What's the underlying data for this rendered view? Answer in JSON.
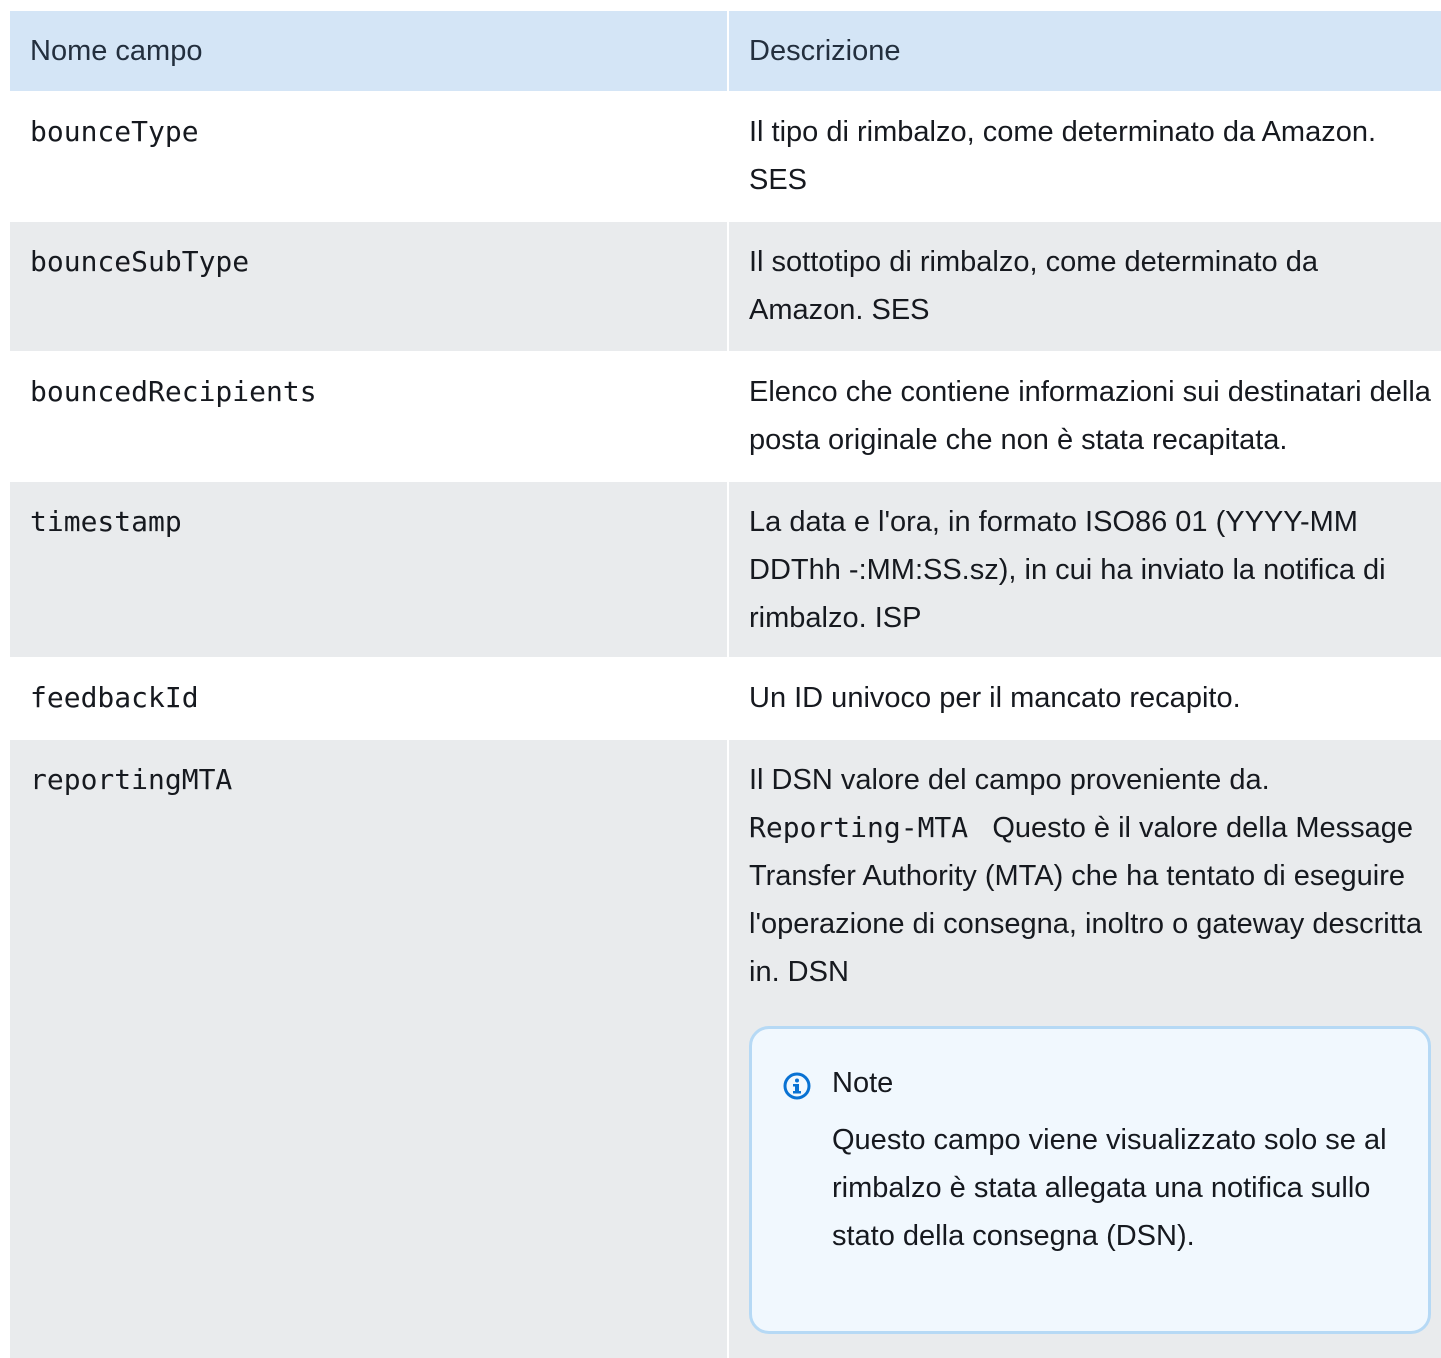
{
  "table": {
    "headers": [
      "Nome campo",
      "Descrizione"
    ],
    "rows": [
      {
        "field": "bounceType",
        "description": "Il tipo di rimbalzo, come determinato da Amazon. SES"
      },
      {
        "field": "bounceSubType",
        "description": "Il sottotipo di rimbalzo, come determinato da Amazon. SES"
      },
      {
        "field": "bouncedRecipients",
        "description": "Elenco che contiene informazioni sui destinatari della posta originale che non è stata recapitata."
      },
      {
        "field": "timestamp",
        "description": "La data e l'ora, in formato ISO86 01 (YYYY-MM DDThh -:MM:SS.sz), in cui ha inviato la notifica di rimbalzo. ISP"
      },
      {
        "field": "feedbackId",
        "description": "Un ID univoco per il mancato recapito."
      },
      {
        "field": "reportingMTA",
        "description_before": "Il DSN valore del campo proveniente da.",
        "description_code": "Reporting-MTA",
        "description_after": "Questo è il valore della Message Transfer Authority (MTA) che ha tentato di eseguire l'operazione di consegna, inoltro o gateway descritta in. DSN"
      }
    ]
  },
  "note": {
    "icon": "info-icon",
    "title": "Note",
    "body": "Questo campo viene visualizzato solo se al rimbalzo è stata allegata una notifica sullo stato della consegna (DSN)."
  },
  "colors": {
    "header_bg": "#d4e5f6",
    "row_alt_bg": "#e9ebed",
    "note_bg": "#f1f8fe",
    "note_border": "#b6d9f5",
    "info_icon": "#0972d3"
  }
}
